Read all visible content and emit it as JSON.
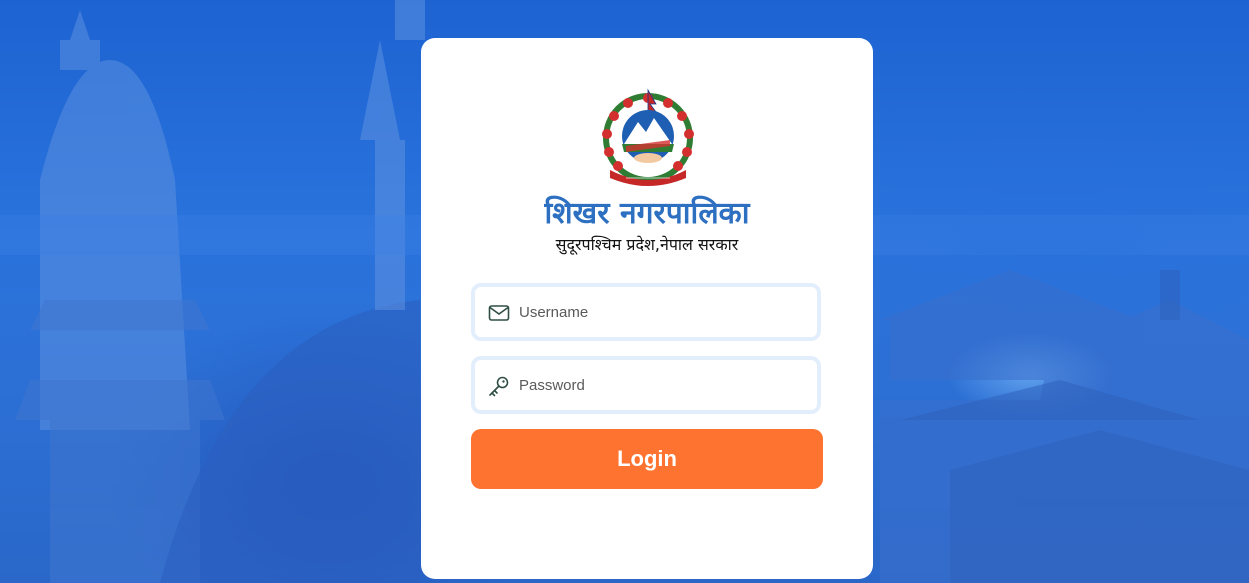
{
  "header": {
    "org_name": "शिखर नगरपालिका",
    "org_subtitle": "सुदूरपश्चिम प्रदेश,नेपाल सरकार"
  },
  "form": {
    "username": {
      "value": "",
      "placeholder": "Username",
      "icon": "envelope-icon"
    },
    "password": {
      "value": "",
      "placeholder": "Password",
      "icon": "key-icon"
    },
    "login_label": "Login"
  },
  "colors": {
    "title": "#2d6fc0",
    "button": "#ff7330",
    "field_border": "#e3eefc",
    "background": "#1d63d2"
  }
}
